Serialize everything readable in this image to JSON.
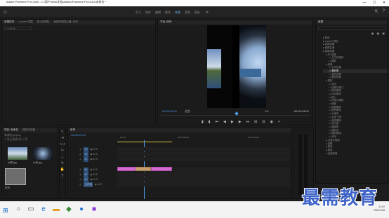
{
  "window": {
    "title": "Adobe Premiere Pro 2020 - C:\\用户\\Win\\文档\\Adobe\\Premiere Pro\\14.0\\未命名 *",
    "min": "—",
    "max": "☐",
    "close": "✕"
  },
  "workspaces": [
    "学习",
    "组件",
    "编辑",
    "颜色",
    "效果",
    "音频",
    "图形",
    "库"
  ],
  "active_workspace": "效果",
  "source_panel": {
    "tabs": [
      "效果控件",
      "Lumetri 范围",
      "源:(无剪辑)",
      "音频剪辑混合器: 序列"
    ],
    "field": "(无剪辑)"
  },
  "program_panel": {
    "tab": "节目: 序列",
    "timecode": "00:00:02:01",
    "fit": "适合",
    "quality": "1/2",
    "end_timecode": "00:00:04:01"
  },
  "transport_icons": [
    "mark-in",
    "mark-out",
    "go-to-in",
    "step-back",
    "play",
    "step-forward",
    "go-to-out",
    "insert",
    "overwrite",
    "export-frame",
    "settings"
  ],
  "effects_panel": {
    "title": "效果",
    "tree": [
      {
        "t": "预设",
        "lv": 0
      },
      {
        "t": "Lumetri 预设",
        "lv": 0
      },
      {
        "t": "音频效果",
        "lv": 0
      },
      {
        "t": "音频过渡",
        "lv": 0
      },
      {
        "t": "视频效果",
        "lv": 0
      },
      {
        "t": "3D 视频",
        "lv": 1
      },
      {
        "t": "立方体旋转",
        "lv": 2
      },
      {
        "t": "翻转",
        "lv": 2
      },
      {
        "t": "划像",
        "lv": 1
      },
      {
        "t": "交叉划像",
        "lv": 2
      },
      {
        "t": "圆划像",
        "lv": 2
      },
      {
        "t": "盒形划像",
        "lv": 2
      },
      {
        "t": "菱形划像",
        "lv": 2
      },
      {
        "t": "擦除",
        "lv": 1
      },
      {
        "t": "划出",
        "lv": 2
      },
      {
        "t": "双侧平推门",
        "lv": 2
      },
      {
        "t": "带状擦除",
        "lv": 2
      },
      {
        "t": "径向擦除",
        "lv": 2
      },
      {
        "t": "插入",
        "lv": 2
      },
      {
        "t": "时钟式擦除",
        "lv": 2
      },
      {
        "t": "棋盘",
        "lv": 2
      },
      {
        "t": "棋盘擦除",
        "lv": 2
      },
      {
        "t": "楔形擦除",
        "lv": 2
      },
      {
        "t": "水波块",
        "lv": 2
      },
      {
        "t": "油漆飞溅",
        "lv": 2
      },
      {
        "t": "渐变擦除",
        "lv": 2
      },
      {
        "t": "百叶窗",
        "lv": 2
      },
      {
        "t": "螺旋框",
        "lv": 2
      },
      {
        "t": "随机块",
        "lv": 2
      },
      {
        "t": "随机擦除",
        "lv": 2
      },
      {
        "t": "风车",
        "lv": 2
      },
      {
        "t": "沉浸式视频",
        "lv": 1
      },
      {
        "t": "溶解",
        "lv": 1
      },
      {
        "t": "滑动",
        "lv": 1
      },
      {
        "t": "缩放",
        "lv": 1
      },
      {
        "t": "页面剥落",
        "lv": 1
      }
    ],
    "selected": "圆划像"
  },
  "project_panel": {
    "tabs": [
      "项目: 未命名",
      "媒体浏览器"
    ],
    "name": "未命名.prproj",
    "count": "1 项已选择,共 3 项",
    "items": [
      {
        "name": "大厦.jpg",
        "dur": "5:00"
      },
      {
        "name": "大桥.jpg",
        "dur": "5:00"
      },
      {
        "name": "序列",
        "dur": "4:01"
      }
    ]
  },
  "timeline": {
    "tab": "序列",
    "timecode": "00:00:02:01",
    "ruler": [
      "00:00",
      "00:00:05:00",
      "00:00:10:00"
    ],
    "tracks": [
      "V3",
      "V2",
      "V1",
      "A1",
      "A2",
      "A3",
      "主声道"
    ],
    "clip1": "大厦.jpg",
    "transition": "圆划像",
    "clip2": "大桥.jpg",
    "master": "0.0"
  },
  "taskbar": {
    "time": "11:02",
    "date": "2021/11/8"
  },
  "watermark": "最需教育"
}
